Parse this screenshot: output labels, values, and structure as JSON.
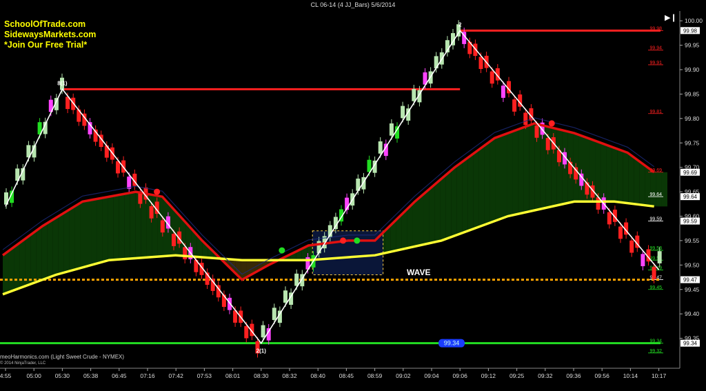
{
  "header": {
    "title": "CL 06-14 (4 JJ_Bars)  5/6/2014"
  },
  "branding": {
    "line1": "SchoolOfTrade.com",
    "line2": "SidewaysMarkets.com",
    "line3": "*Join Our Free Trial*"
  },
  "footer": {
    "source": "meoHarmonics.com (Light Sweet Crude - NYMEX)",
    "copyright": "© 2014 NinjaTrader, LLC"
  },
  "annotation": {
    "wave": "WAVE"
  },
  "controls": {
    "play_icon": "play-pause-icon"
  },
  "colors": {
    "background": "#000000",
    "up_bar": "#b8e6b0",
    "down_bar": "#ff2020",
    "neutral_bar": "#ff44ff",
    "fast_ma": "#e11010",
    "slow_ma": "#ffff33",
    "bottom_line": "#22dd22",
    "zigzag": "#ffffff",
    "support": "#ffa500"
  },
  "chart_data": {
    "type": "candlestick",
    "title": "CL 06-14 (4 JJ_Bars)  5/6/2014",
    "x_ticks": [
      "4:55",
      "05:00",
      "05:30",
      "05:38",
      "06:45",
      "07:16",
      "07:42",
      "07:53",
      "08:01",
      "08:30",
      "08:32",
      "08:40",
      "08:45",
      "08:59",
      "09:02",
      "09:04",
      "09:06",
      "09:12",
      "09:25",
      "09:32",
      "09:36",
      "09:56",
      "10:14",
      "10:17"
    ],
    "ylim": [
      99.3,
      100.02
    ],
    "y_ticks": [
      99.35,
      99.4,
      99.45,
      99.5,
      99.55,
      99.6,
      99.65,
      99.7,
      99.75,
      99.8,
      99.85,
      99.9,
      99.95,
      100.0
    ],
    "price_levels": [
      {
        "value": 99.98,
        "color": "#ff2020"
      },
      {
        "value": 99.94,
        "color": "#ff2020"
      },
      {
        "value": 99.91,
        "color": "#ff2020"
      },
      {
        "value": 99.81,
        "color": "#ff2020"
      },
      {
        "value": 99.69,
        "color": "#ff2020"
      },
      {
        "value": 99.64,
        "color": "#ffffff"
      },
      {
        "value": 99.59,
        "color": "#ffffff"
      },
      {
        "value": 99.53,
        "color": "#22dd22"
      },
      {
        "value": 99.51,
        "color": "#22dd22"
      },
      {
        "value": 99.49,
        "color": "#22dd22"
      },
      {
        "value": 99.47,
        "color": "#ffffff"
      },
      {
        "value": 99.45,
        "color": "#22dd22"
      },
      {
        "value": 99.34,
        "color": "#22dd22"
      },
      {
        "value": 99.32,
        "color": "#22dd22"
      }
    ],
    "axis_boxes": [
      {
        "value": 99.98,
        "text": "99.98"
      },
      {
        "value": 99.69,
        "text": "99.69"
      },
      {
        "value": 99.64,
        "text": "99.64"
      },
      {
        "value": 99.59,
        "text": "99.59"
      },
      {
        "value": 99.47,
        "text": "99.47"
      },
      {
        "value": 99.34,
        "text": "99.34"
      }
    ],
    "horizontal_lines": [
      {
        "name": "resistance",
        "value": 99.86,
        "color": "#ff2020",
        "x_start": "05:30",
        "x_end": "09:06"
      },
      {
        "name": "high",
        "value": 99.98,
        "color": "#ff2020",
        "x_start": "09:06",
        "x_end": "10:17"
      },
      {
        "name": "support",
        "value": 99.47,
        "color": "#ffa500",
        "dashed": true
      },
      {
        "name": "low",
        "value": 99.34,
        "color": "#22dd22"
      }
    ],
    "bottom_line_label": "99.34",
    "zigzag": [
      {
        "x": "4:55",
        "y": 99.62
      },
      {
        "x": "05:30",
        "y": 99.86,
        "label": "8(1)"
      },
      {
        "x": "08:30",
        "y": 99.34,
        "label": "2(1)"
      },
      {
        "x": "09:06",
        "y": 99.98,
        "label": "2"
      },
      {
        "x": "10:17",
        "y": 99.49
      }
    ],
    "fast_ma": [
      [
        0,
        99.52
      ],
      [
        0.06,
        99.58
      ],
      [
        0.12,
        99.63
      ],
      [
        0.2,
        99.65
      ],
      [
        0.24,
        99.64
      ],
      [
        0.3,
        99.55
      ],
      [
        0.36,
        99.47
      ],
      [
        0.4,
        99.5
      ],
      [
        0.46,
        99.54
      ],
      [
        0.52,
        99.55
      ],
      [
        0.56,
        99.55
      ],
      [
        0.62,
        99.63
      ],
      [
        0.68,
        99.7
      ],
      [
        0.74,
        99.76
      ],
      [
        0.8,
        99.79
      ],
      [
        0.86,
        99.77
      ],
      [
        0.9,
        99.75
      ],
      [
        0.94,
        99.73
      ],
      [
        0.98,
        99.69
      ]
    ],
    "slow_ma": [
      [
        0,
        99.44
      ],
      [
        0.08,
        99.48
      ],
      [
        0.16,
        99.51
      ],
      [
        0.26,
        99.52
      ],
      [
        0.36,
        99.51
      ],
      [
        0.46,
        99.51
      ],
      [
        0.56,
        99.52
      ],
      [
        0.66,
        99.55
      ],
      [
        0.76,
        99.6
      ],
      [
        0.86,
        99.63
      ],
      [
        0.92,
        99.63
      ],
      [
        0.98,
        99.62
      ]
    ],
    "wave_box": {
      "x_start": "08:40",
      "x_end": "08:59",
      "y_low": 99.48,
      "y_high": 99.57
    },
    "signal_dots": [
      {
        "x": 0.232,
        "y": 99.65,
        "color": "#ff2020"
      },
      {
        "x": 0.42,
        "y": 99.53,
        "color": "#22dd22"
      },
      {
        "x": 0.512,
        "y": 99.55,
        "color": "#ff2020"
      },
      {
        "x": 0.533,
        "y": 99.55,
        "color": "#22dd22"
      },
      {
        "x": 0.826,
        "y": 99.79,
        "color": "#ff2020"
      }
    ]
  }
}
